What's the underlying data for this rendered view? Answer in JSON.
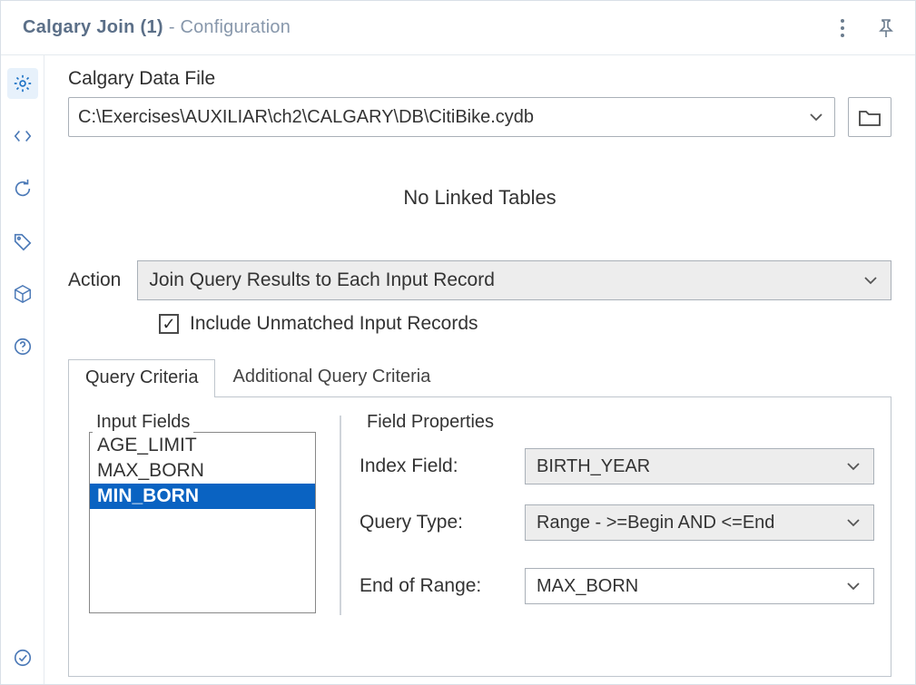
{
  "titlebar": {
    "title": "Calgary Join (1)",
    "subtitle": "- Configuration"
  },
  "file": {
    "label": "Calgary Data File",
    "path": "C:\\Exercises\\AUXILIAR\\ch2\\CALGARY\\DB\\CitiBike.cydb"
  },
  "linked_tables_msg": "No Linked Tables",
  "action": {
    "label": "Action",
    "selected": "Join Query Results to Each Input Record",
    "include_unmatched_label": "Include Unmatched Input Records",
    "include_unmatched_checked": true
  },
  "tabs": {
    "query_criteria": "Query Criteria",
    "additional_query_criteria": "Additional Query Criteria"
  },
  "input_fields": {
    "legend": "Input Fields",
    "items": [
      "AGE_LIMIT",
      "MAX_BORN",
      "MIN_BORN"
    ],
    "selected_index": 2
  },
  "field_properties": {
    "legend": "Field Properties",
    "index_field_label": "Index Field:",
    "index_field_value": "BIRTH_YEAR",
    "query_type_label": "Query Type:",
    "query_type_value": "Range - >=Begin AND <=End",
    "end_of_range_label": "End of Range:",
    "end_of_range_value": "MAX_BORN"
  }
}
